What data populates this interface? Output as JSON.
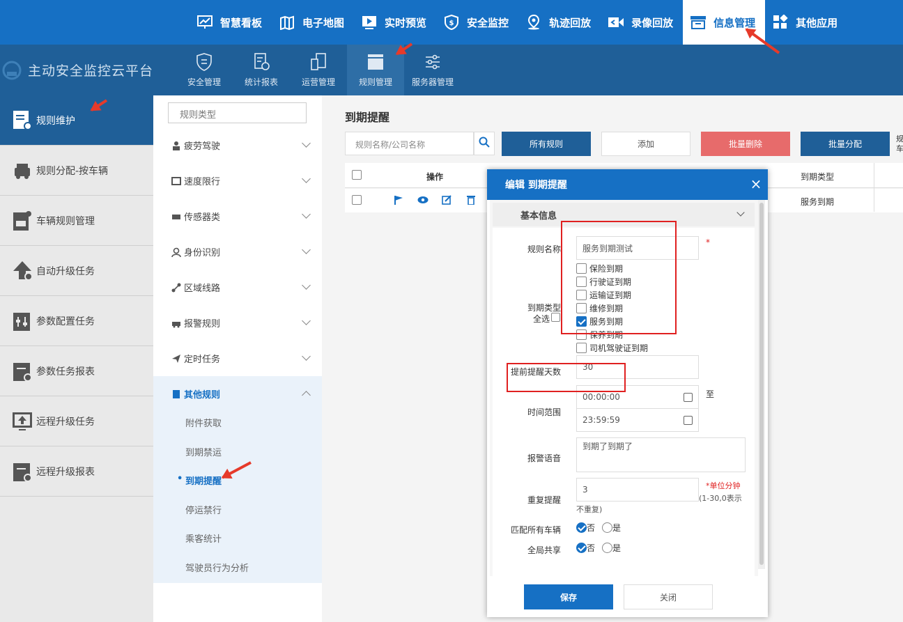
{
  "topnav": [
    {
      "label": "智慧看板",
      "icon": "dashboard-icon"
    },
    {
      "label": "电子地图",
      "icon": "map-icon"
    },
    {
      "label": "实时预览",
      "icon": "play-icon"
    },
    {
      "label": "安全监控",
      "icon": "shield-icon"
    },
    {
      "label": "轨迹回放",
      "icon": "location-icon"
    },
    {
      "label": "录像回放",
      "icon": "video-icon"
    },
    {
      "label": "信息管理",
      "icon": "info-icon",
      "active": true
    },
    {
      "label": "其他应用",
      "icon": "apps-icon"
    }
  ],
  "brand": {
    "title": "主动安全监控云平台"
  },
  "subnav": [
    {
      "label": "安全管理",
      "icon": "safety-icon"
    },
    {
      "label": "统计报表",
      "icon": "report-icon"
    },
    {
      "label": "运营管理",
      "icon": "operation-icon"
    },
    {
      "label": "规则管理",
      "icon": "rules-icon",
      "active": true
    },
    {
      "label": "服务器管理",
      "icon": "server-icon"
    }
  ],
  "leftnav": [
    {
      "label": "规则维护",
      "active": true
    },
    {
      "label": "规则分配-按车辆"
    },
    {
      "label": "车辆规则管理"
    },
    {
      "label": "自动升级任务"
    },
    {
      "label": "参数配置任务"
    },
    {
      "label": "参数任务报表"
    },
    {
      "label": "远程升级任务"
    },
    {
      "label": "远程升级报表"
    }
  ],
  "midnav": {
    "search_placeholder": "规则类型",
    "categories": [
      "疲劳驾驶",
      "速度限行",
      "传感器类",
      "身份识别",
      "区域线路",
      "报警规则",
      "定时任务",
      "其他规则"
    ],
    "subitems": [
      "附件获取",
      "到期禁运",
      "到期提醒",
      "停运禁行",
      "乘客统计",
      "驾驶员行为分析"
    ],
    "active_subitem": "到期提醒"
  },
  "content": {
    "title": "到期提醒",
    "search_placeholder": "规则名称/公司名称",
    "btn_all": "所有规则",
    "btn_add": "添加",
    "btn_batch_delete": "批量删除",
    "btn_batch_assign": "批量分配",
    "cut_text_1": "规",
    "cut_text_2": "车",
    "col_ops": "操作",
    "col_type": "到期类型",
    "row_type": "服务到期"
  },
  "dialog": {
    "title": "编辑   到期提醒",
    "section": "基本信息",
    "rule_name_label": "规则名称",
    "rule_name_value": "服务到期测试",
    "required_mark": "*",
    "expire_type_label": "到期类型",
    "select_all_label": "全选",
    "expire_types": [
      {
        "label": "保险到期",
        "checked": false
      },
      {
        "label": "行驶证到期",
        "checked": false
      },
      {
        "label": "运输证到期",
        "checked": false
      },
      {
        "label": "维修到期",
        "checked": false
      },
      {
        "label": "服务到期",
        "checked": true
      },
      {
        "label": "保养到期",
        "checked": false
      },
      {
        "label": "司机驾驶证到期",
        "checked": false
      }
    ],
    "advance_days_label": "提前提醒天数",
    "advance_days_value": "30",
    "time_range_label": "时间范围",
    "time_start": "00:00:00",
    "time_end": "23:59:59",
    "time_to": "至",
    "voice_label": "报警语音",
    "voice_value": "到期了到期了",
    "repeat_label": "重复提醒",
    "repeat_value": "3",
    "repeat_hint_1": "*单位分钟",
    "repeat_hint_2": "(1-30,0表示",
    "repeat_hint_3": "不重复)",
    "match_all_label": "匹配所有车辆",
    "share_label": "全局共享",
    "opt_no": "否",
    "opt_yes": "是",
    "save": "保存",
    "close": "关闭"
  },
  "colors": {
    "primary": "#1670c4",
    "subbar": "#1f5f98",
    "danger": "#e76b6b",
    "highlight": "#e02020"
  }
}
